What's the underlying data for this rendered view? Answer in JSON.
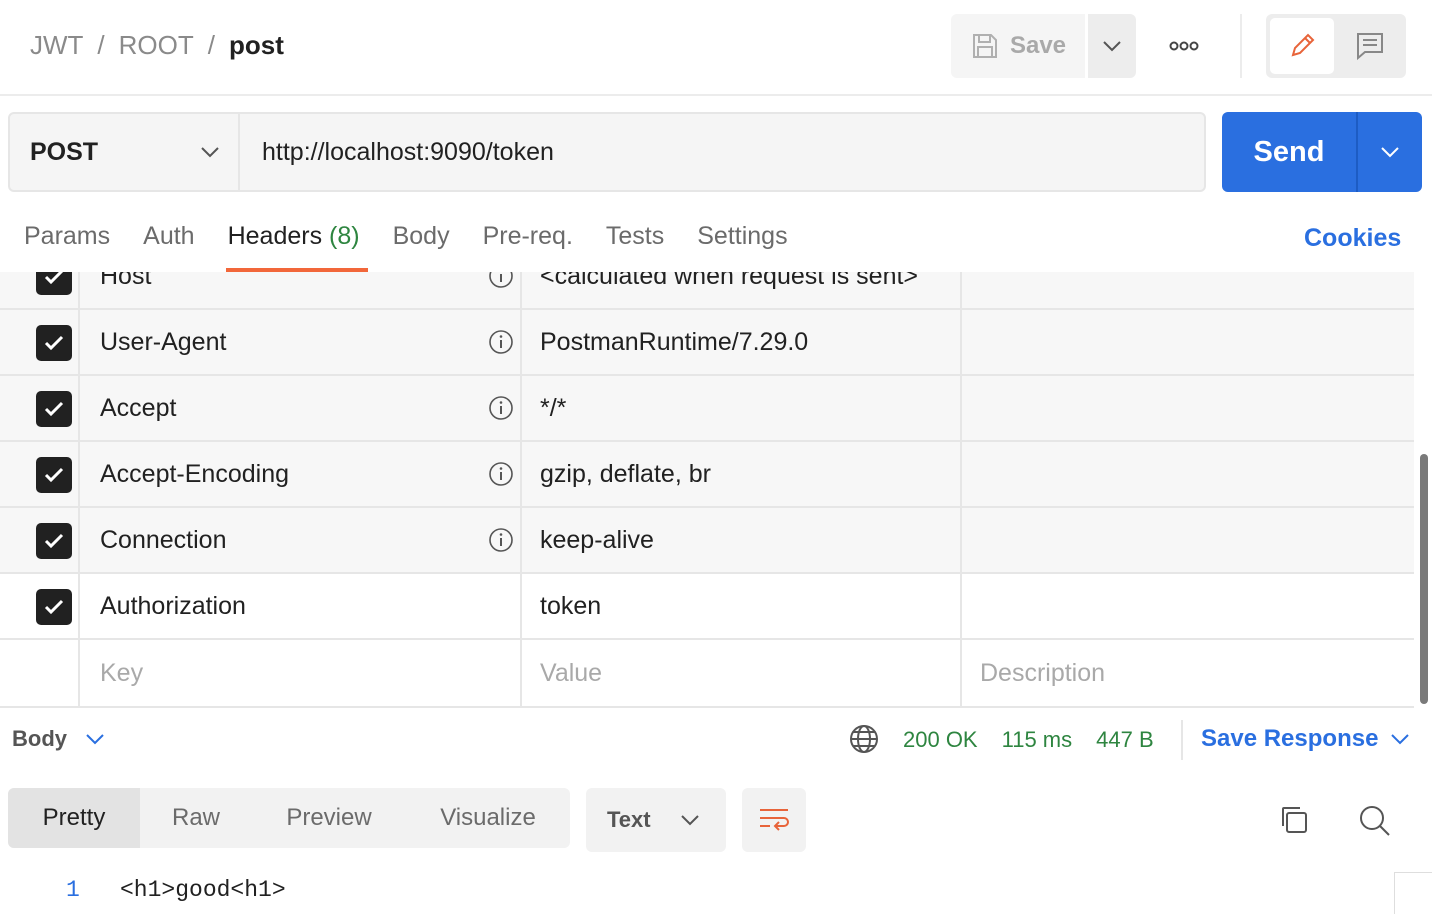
{
  "breadcrumb": {
    "part1": "JWT",
    "sep": "/",
    "part2": "ROOT",
    "current": "post"
  },
  "toolbar": {
    "save_label": "Save"
  },
  "request": {
    "method": "POST",
    "url": "http://localhost:9090/token",
    "send_label": "Send"
  },
  "tabs": {
    "params": "Params",
    "auth": "Auth",
    "headers": "Headers",
    "headers_count": "(8)",
    "body": "Body",
    "prereq": "Pre-req.",
    "tests": "Tests",
    "settings": "Settings",
    "cookies": "Cookies"
  },
  "headers": [
    {
      "key": "Host",
      "value": "<calculated when request is sent>",
      "description": "",
      "checked": true
    },
    {
      "key": "User-Agent",
      "value": "PostmanRuntime/7.29.0",
      "description": "",
      "checked": true
    },
    {
      "key": "Accept",
      "value": "*/*",
      "description": "",
      "checked": true
    },
    {
      "key": "Accept-Encoding",
      "value": "gzip, deflate, br",
      "description": "",
      "checked": true
    },
    {
      "key": "Connection",
      "value": "keep-alive",
      "description": "",
      "checked": true
    },
    {
      "key": "Authorization",
      "value": "token",
      "description": "",
      "checked": true
    }
  ],
  "new_row": {
    "key_placeholder": "Key",
    "value_placeholder": "Value",
    "description_placeholder": "Description"
  },
  "response": {
    "section_label": "Body",
    "status": "200 OK",
    "time": "115 ms",
    "size": "447 B",
    "save_label": "Save Response",
    "views": [
      "Pretty",
      "Raw",
      "Preview",
      "Visualize"
    ],
    "format": "Text",
    "lines": [
      {
        "num": "1",
        "code": "<h1>good<h1>"
      }
    ]
  },
  "colors": {
    "accent": "#2a6fe0",
    "active_tab": "#f2673a",
    "status_ok": "#2e8540"
  },
  "icons": [
    "save-icon",
    "chevron-down-icon",
    "more-icon",
    "pencil-icon",
    "comment-icon",
    "info-icon",
    "globe-icon",
    "wrap-lines-icon",
    "copy-icon",
    "search-icon",
    "checkmark-icon"
  ]
}
